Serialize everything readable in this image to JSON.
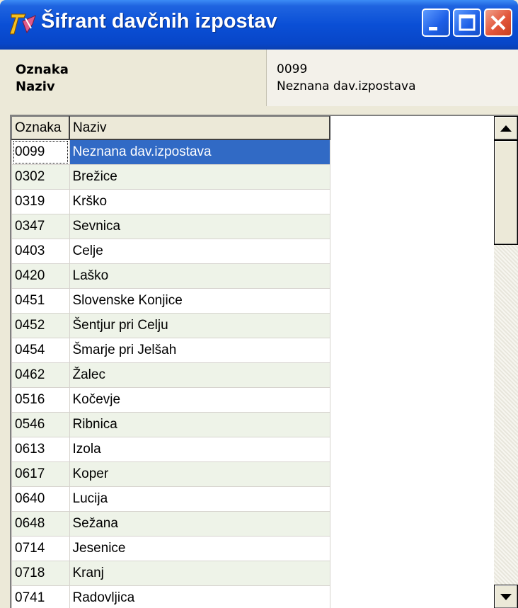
{
  "window": {
    "title": "Šifrant davčnih izpostav",
    "icon": "app-logo-icon",
    "buttons": [
      "minimize-icon",
      "maximize-icon",
      "close-icon"
    ]
  },
  "info": {
    "labels": [
      "Oznaka",
      "Naziv"
    ],
    "values": [
      "0099",
      "Neznana dav.izpostava"
    ]
  },
  "grid": {
    "columns": [
      "Oznaka",
      "Naziv"
    ],
    "rows": [
      [
        "0099",
        "Neznana dav.izpostava"
      ],
      [
        "0302",
        "Brežice"
      ],
      [
        "0319",
        "Krško"
      ],
      [
        "0347",
        "Sevnica"
      ],
      [
        "0403",
        "Celje"
      ],
      [
        "0420",
        "Laško"
      ],
      [
        "0451",
        "Slovenske Konjice"
      ],
      [
        "0452",
        "Šentjur pri Celju"
      ],
      [
        "0454",
        "Šmarje pri Jelšah"
      ],
      [
        "0462",
        "Žalec"
      ],
      [
        "0516",
        "Kočevje"
      ],
      [
        "0546",
        "Ribnica"
      ],
      [
        "0613",
        "Izola"
      ],
      [
        "0617",
        "Koper"
      ],
      [
        "0640",
        "Lucija"
      ],
      [
        "0648",
        "Sežana"
      ],
      [
        "0714",
        "Jesenice"
      ],
      [
        "0718",
        "Kranj"
      ],
      [
        "0741",
        "Radovljica"
      ]
    ],
    "selected_row": 0
  },
  "colors": {
    "selection": "#316ac5",
    "alternate_row": "#eef3e8",
    "titlebar": "#0a4fd6"
  }
}
